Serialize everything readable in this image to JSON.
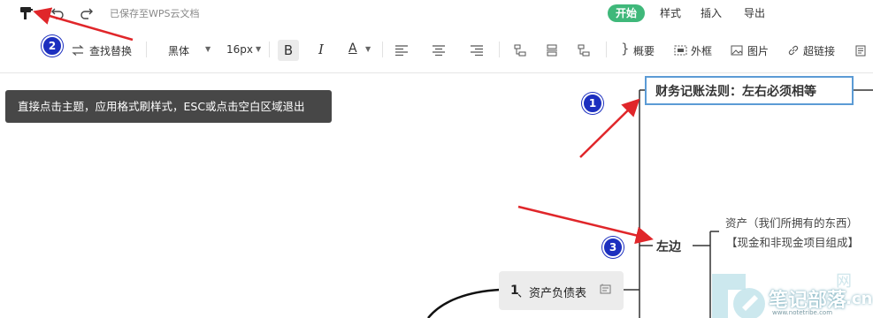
{
  "header": {
    "saved_status": "已保存至WPS云文档",
    "tabs": [
      {
        "label": "开始",
        "active": true
      },
      {
        "label": "样式",
        "active": false
      },
      {
        "label": "插入",
        "active": false
      },
      {
        "label": "导出",
        "active": false
      }
    ]
  },
  "toolbar": {
    "find_replace": "查找替换",
    "font_family": "黑体",
    "font_size": "16px",
    "bold": "B",
    "italic": "I",
    "font_color": "A",
    "summary": "概要",
    "outer_frame": "外框",
    "image": "图片",
    "hyperlink": "超链接"
  },
  "tooltip": {
    "text": "直接点击主题，应用格式刷样式，ESC或点击空白区域退出"
  },
  "mindmap": {
    "root_topic": "财务记账法则：左右必须相等",
    "left_branch": "左边",
    "asset_line1": "资产（我们所拥有的东西）",
    "asset_line2": "【现金和非现金项目组成】",
    "balance_sheet_num": "1",
    "balance_sheet_label": "、资产负债表"
  },
  "annotations": {
    "badge1": "1",
    "badge2": "2",
    "badge3": "3"
  },
  "watermark": {
    "text": "笔记部落",
    "domain": ".cn",
    "url": "www.notetribe.com",
    "faint": "网"
  },
  "colors": {
    "accent_green": "#3fb87a",
    "arrow_red": "#e0262a",
    "badge_blue": "#1c2fbf",
    "selection_blue": "#5b9bd5"
  }
}
